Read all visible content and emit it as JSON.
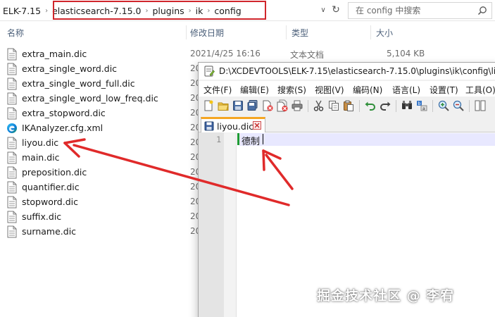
{
  "explorer": {
    "breadcrumbs": [
      "ELK-7.15",
      "elasticsearch-7.15.0",
      "plugins",
      "ik",
      "config"
    ],
    "search_placeholder": "在 config 中搜索",
    "columns": {
      "name": "名称",
      "date": "修改日期",
      "type": "类型",
      "size": "大小"
    },
    "files": [
      {
        "name": "extra_main.dic",
        "date": "2021/4/25 16:16",
        "type": "文本文档",
        "size": "5,104 KB",
        "icon": "text-file-icon"
      },
      {
        "name": "extra_single_word.dic",
        "date": "20",
        "icon": "text-file-icon"
      },
      {
        "name": "extra_single_word_full.dic",
        "date": "20",
        "icon": "text-file-icon"
      },
      {
        "name": "extra_single_word_low_freq.dic",
        "date": "20",
        "icon": "text-file-icon"
      },
      {
        "name": "extra_stopword.dic",
        "date": "20",
        "icon": "text-file-icon"
      },
      {
        "name": "IKAnalyzer.cfg.xml",
        "date": "20",
        "icon": "edge-xml-icon"
      },
      {
        "name": "liyou.dic",
        "date": "20",
        "icon": "text-file-icon"
      },
      {
        "name": "main.dic",
        "date": "20",
        "icon": "text-file-icon"
      },
      {
        "name": "preposition.dic",
        "date": "20",
        "icon": "text-file-icon"
      },
      {
        "name": "quantifier.dic",
        "date": "20",
        "icon": "text-file-icon"
      },
      {
        "name": "stopword.dic",
        "date": "20",
        "icon": "text-file-icon"
      },
      {
        "name": "suffix.dic",
        "date": "20",
        "icon": "text-file-icon"
      },
      {
        "name": "surname.dic",
        "date": "20",
        "icon": "text-file-icon"
      }
    ]
  },
  "notepad": {
    "title": "D:\\XCDEVTOOLS\\ELK-7.15\\elasticsearch-7.15.0\\plugins\\ik\\config\\liyo",
    "menu": [
      "文件(F)",
      "编辑(E)",
      "搜索(S)",
      "视图(V)",
      "编码(N)",
      "语言(L)",
      "设置(T)",
      "工具(O)"
    ],
    "tab_label": "liyou.dic",
    "line_number": "1",
    "line_text": "德制"
  },
  "watermark": "掘金技术社区 @ 李宥",
  "colors": {
    "highlight_box": "#d0262c",
    "arrow": "#e02a2a",
    "tab_accent": "#f5a623",
    "change_marker": "#1e9b33"
  }
}
